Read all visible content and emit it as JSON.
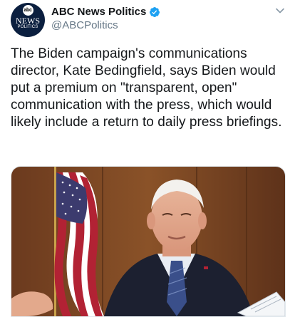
{
  "author": {
    "display_name": "ABC News Politics",
    "handle": "@ABCPolitics",
    "verified": true,
    "avatar": {
      "logo_text": "abc",
      "news_text": "NEWS",
      "politics_text": "POLITICS"
    }
  },
  "tweet": {
    "text": "The Biden campaign's communications director, Kate Bedingfield, says Biden would put a premium on \"transparent, open\" communication with the press, which would likely include a return to daily press briefings."
  },
  "icons": {
    "verified": "verified-badge-icon",
    "menu": "chevron-down-icon"
  },
  "colors": {
    "verified_blue": "#1da1f2",
    "handle_gray": "#657786",
    "text": "#14171a"
  }
}
